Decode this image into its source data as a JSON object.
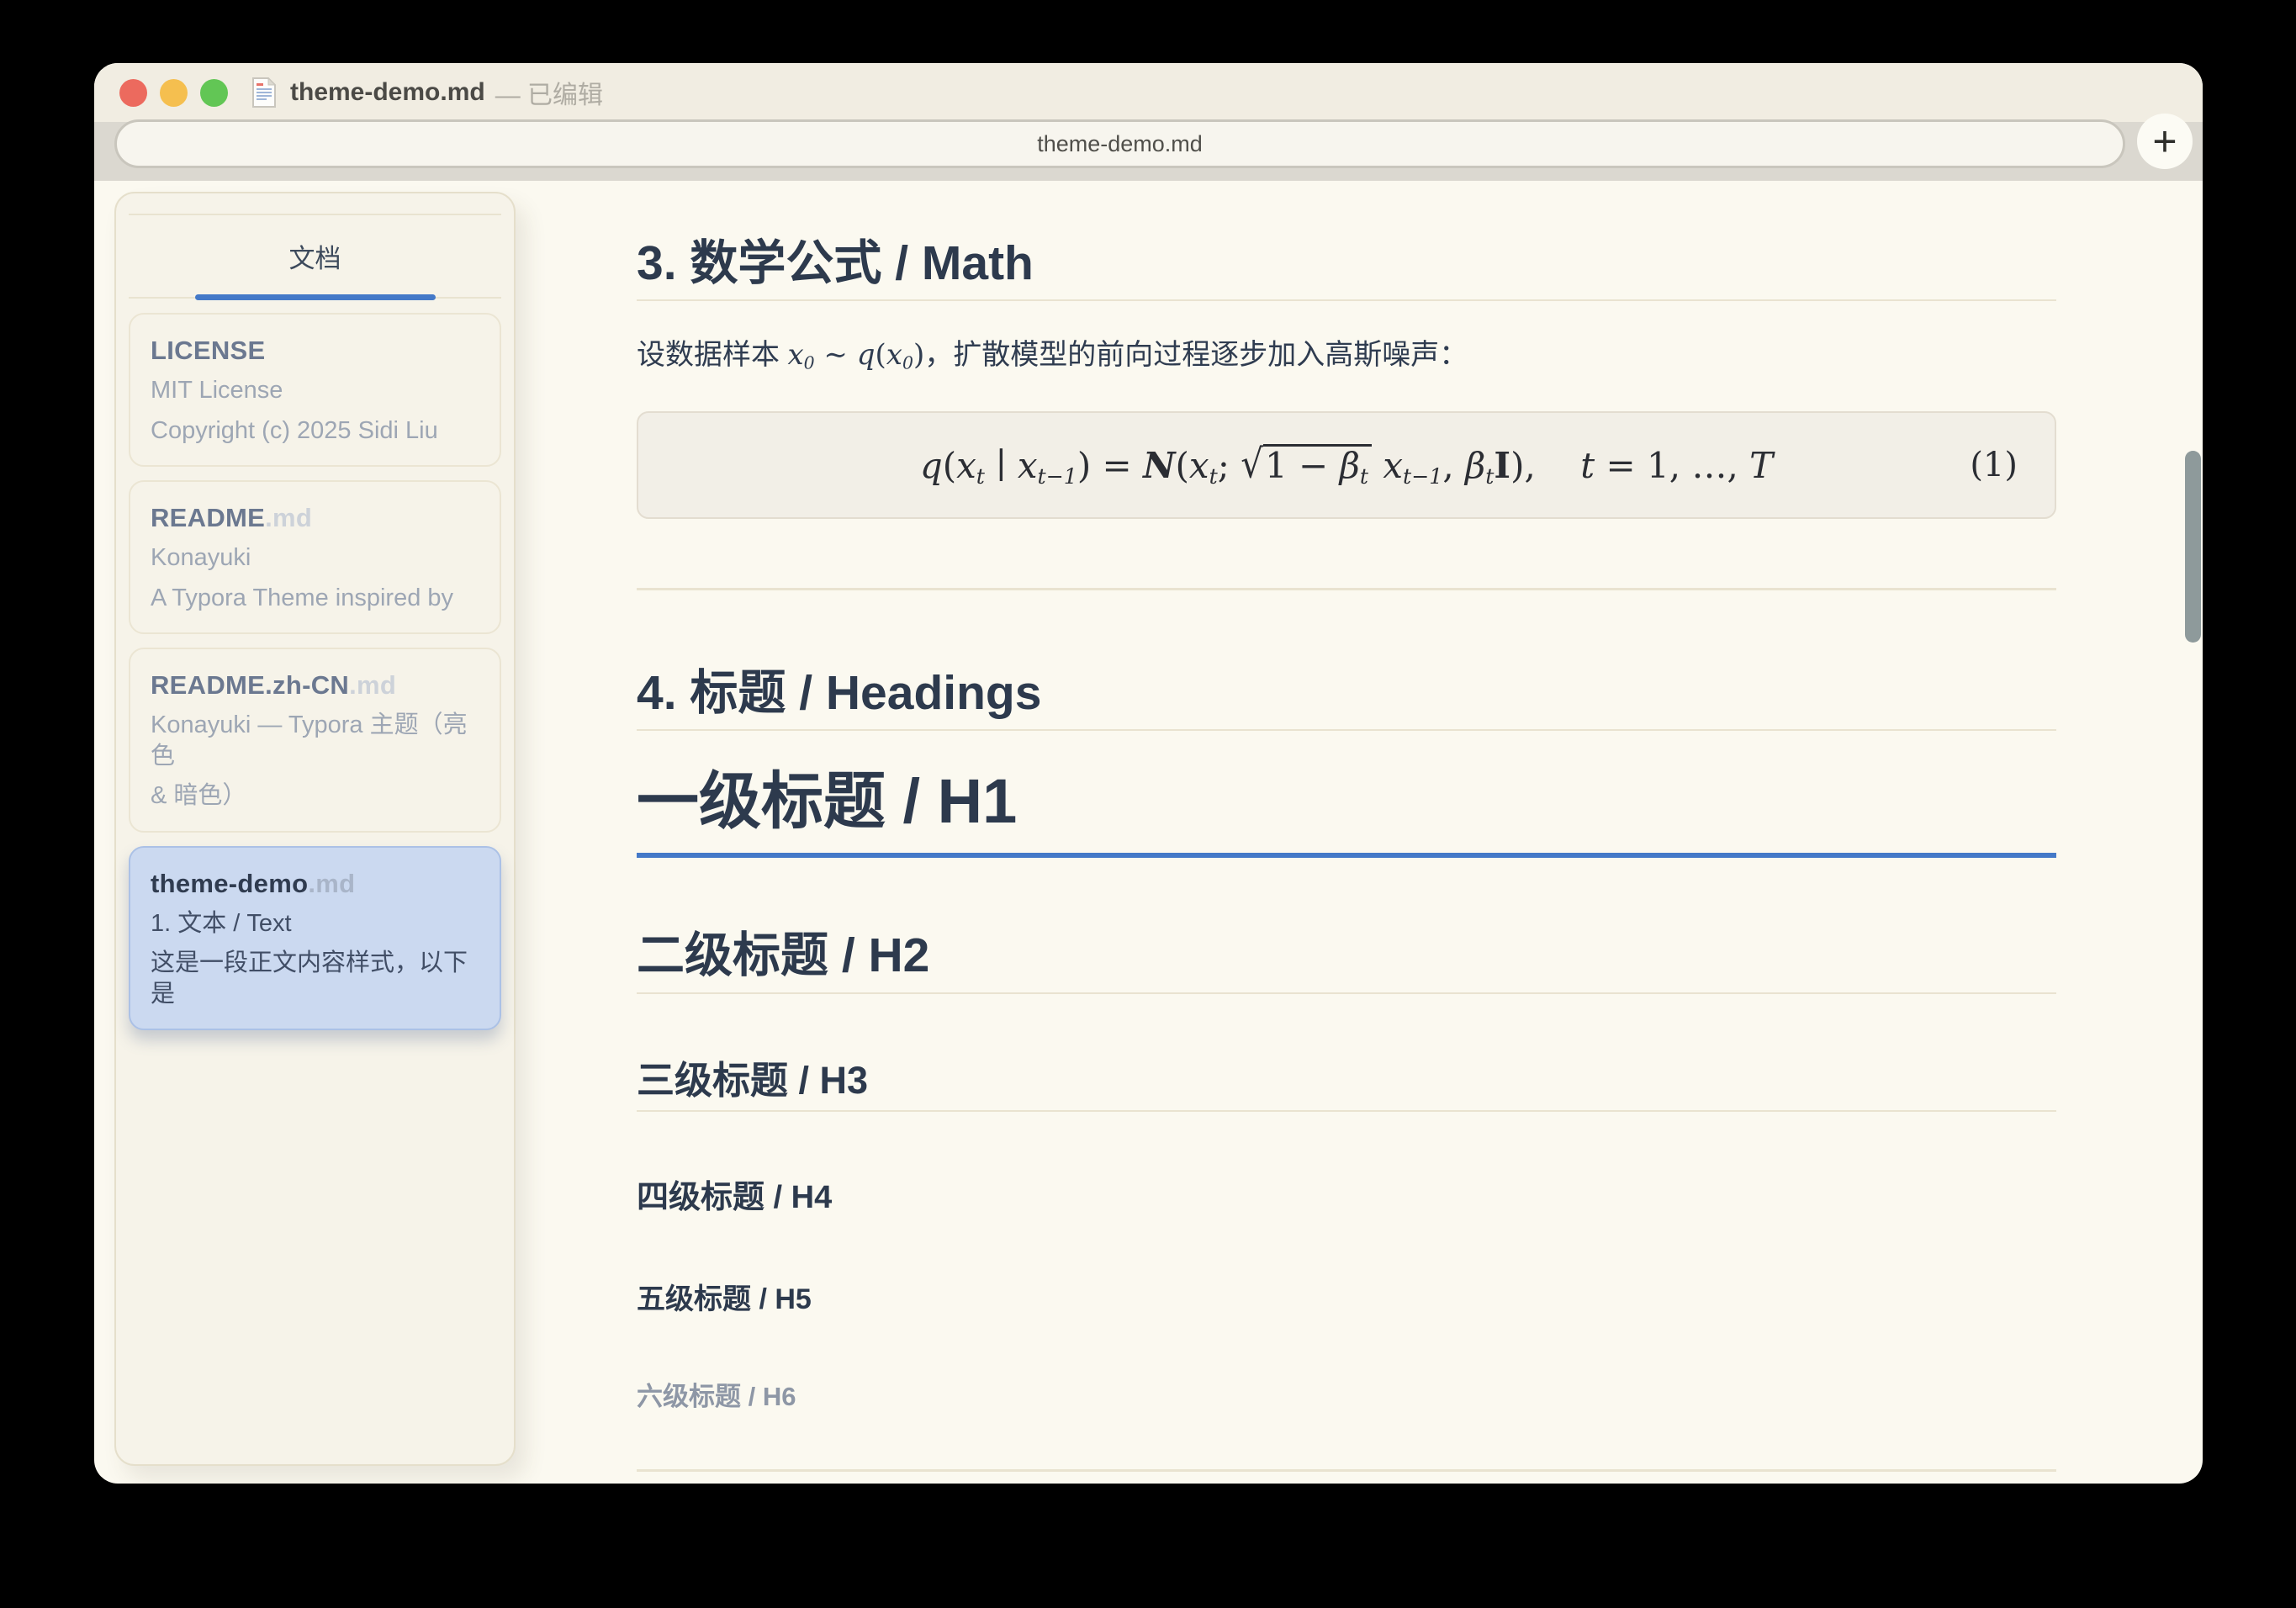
{
  "window": {
    "title_filename": "theme-demo.md",
    "title_suffix": "— 已编辑",
    "tab_label": "theme-demo.md",
    "new_tab_label": "+"
  },
  "sidebar": {
    "tab_label": "文档",
    "files": [
      {
        "name": "LICENSE",
        "ext": "",
        "preview1": "MIT License",
        "preview2": "Copyright (c) 2025 Sidi Liu",
        "selected": false
      },
      {
        "name": "README",
        "ext": ".md",
        "preview1": "Konayuki",
        "preview2": "A Typora Theme inspired by",
        "selected": false
      },
      {
        "name": "README.zh-CN",
        "ext": ".md",
        "preview1": "Konayuki — Typora 主题（亮色",
        "preview2": "& 暗色）",
        "selected": false
      },
      {
        "name": "theme-demo",
        "ext": ".md",
        "preview1": "1. 文本 / Text",
        "preview2": "这是一段正文内容样式，以下是",
        "selected": true
      }
    ]
  },
  "content": {
    "math_section_title": "3. 数学公式 / Math",
    "intro_plain": "设数据样本 x₀ ∼ q(x₀)，扩散模型的前向过程逐步加入高斯噪声：",
    "intro_segments": [
      {
        "c": "cn",
        "x": "设数据样本 "
      },
      {
        "c": "v",
        "x": "x"
      },
      {
        "c": "sub",
        "x": "0"
      },
      {
        "c": "r",
        "x": " ∼ "
      },
      {
        "c": "v",
        "x": "q"
      },
      {
        "c": "r",
        "x": "("
      },
      {
        "c": "v",
        "x": "x"
      },
      {
        "c": "sub",
        "x": "0"
      },
      {
        "c": "r",
        "x": ")"
      },
      {
        "c": "cn",
        "x": "，扩散模型的前向过程逐步加入高斯噪声："
      }
    ],
    "equation": {
      "plain": "q(x_t ∣ x_{t−1}) = N(x_t; √(1 − β_t) x_{t−1}, β_t I),  t = 1, …, T",
      "number": "(1)",
      "segments": [
        {
          "c": "v",
          "x": "q"
        },
        {
          "c": "r",
          "x": "("
        },
        {
          "c": "v",
          "x": "x"
        },
        {
          "c": "sub",
          "x": "t"
        },
        {
          "c": "r",
          "x": " ∣ "
        },
        {
          "c": "v",
          "x": "x"
        },
        {
          "c": "sub",
          "x": "t−1"
        },
        {
          "c": "r",
          "x": ") = "
        },
        {
          "c": "scr",
          "x": "N"
        },
        {
          "c": "r",
          "x": "("
        },
        {
          "c": "v",
          "x": "x"
        },
        {
          "c": "sub",
          "x": "t"
        },
        {
          "c": "r",
          "x": "; "
        },
        {
          "sqrt": [
            {
              "c": "r",
              "x": "1 − "
            },
            {
              "c": "v",
              "x": "β"
            },
            {
              "c": "sub",
              "x": "t"
            }
          ]
        },
        {
          "c": "r",
          "x": " "
        },
        {
          "c": "v",
          "x": "x"
        },
        {
          "c": "sub",
          "x": "t−1"
        },
        {
          "c": "r",
          "x": ", "
        },
        {
          "c": "v",
          "x": "β"
        },
        {
          "c": "sub",
          "x": "t"
        },
        {
          "c": "bi",
          "x": "I"
        },
        {
          "c": "r",
          "x": "),"
        },
        {
          "c": "r",
          "x": "    "
        },
        {
          "c": "v",
          "x": "t"
        },
        {
          "c": "r",
          "x": " = 1, …, "
        },
        {
          "c": "v",
          "x": "T"
        }
      ]
    },
    "headings_section_title": "4. 标题 / Headings",
    "h1": "一级标题 / H1",
    "h2": "二级标题 / H2",
    "h3": "三级标题 / H3",
    "h4": "四级标题 / H4",
    "h5": "五级标题 / H5",
    "h6": "六级标题 / H6"
  },
  "colors": {
    "content-bg": "#FBF9F0",
    "titlebar-bg": "#F1EDE2",
    "accent-blue": "#4479C8",
    "heading": "#2D3A4D",
    "rule": "#E9E3D0",
    "traffic-red": "#EC6A5E",
    "traffic-yellow": "#F5BF4F",
    "traffic-green": "#62C655",
    "selected-bg": "#CBD9F0",
    "selected-border": "#ABC1E6",
    "scrollbar": "#8E9A9B"
  }
}
